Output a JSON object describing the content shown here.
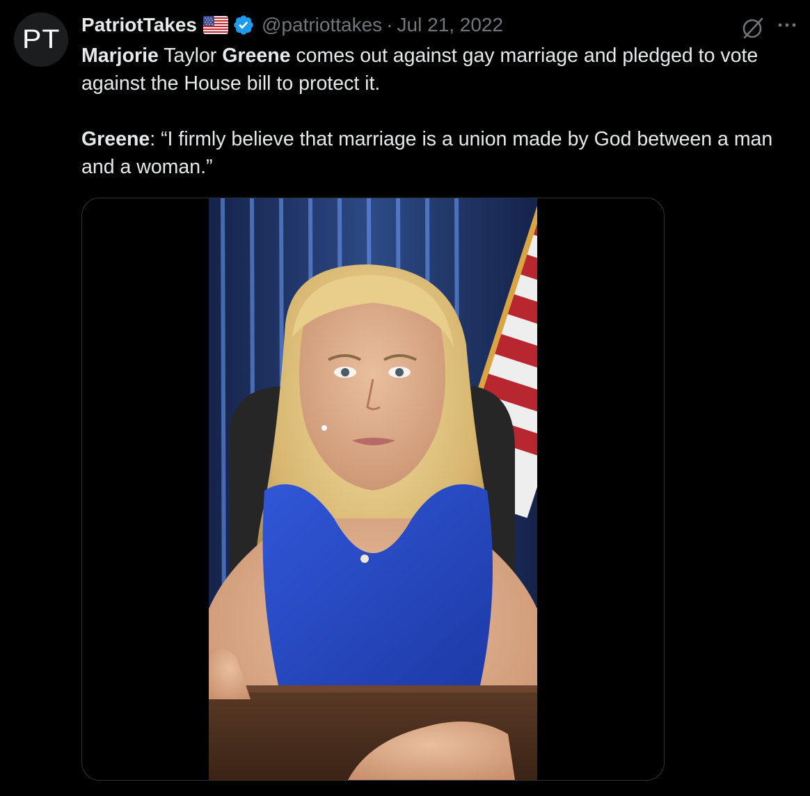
{
  "tweet": {
    "avatar_initials": "PT",
    "display_name": "PatriotTakes",
    "handle": "@patriottakes",
    "separator": "·",
    "date": "Jul 21, 2022",
    "icons": {
      "flag": "us-flag-emoji",
      "verified": "verified-badge-icon",
      "grok": "grok-icon",
      "more": "more-icon"
    },
    "colors": {
      "background": "#000000",
      "text": "#e7e9ea",
      "secondary": "#71767b",
      "verified": "#1d9bf0",
      "border": "#2f3336"
    },
    "body": {
      "p1_b1": "Marjorie",
      "p1_t1": " Taylor ",
      "p1_b2": "Greene",
      "p1_t2": " comes out against gay marriage and pledged to vote against the House bill to protect it.",
      "p2_b1": "Greene",
      "p2_t1": ": “I firmly believe that marriage is a union made by God between a man and a woman.”"
    }
  }
}
